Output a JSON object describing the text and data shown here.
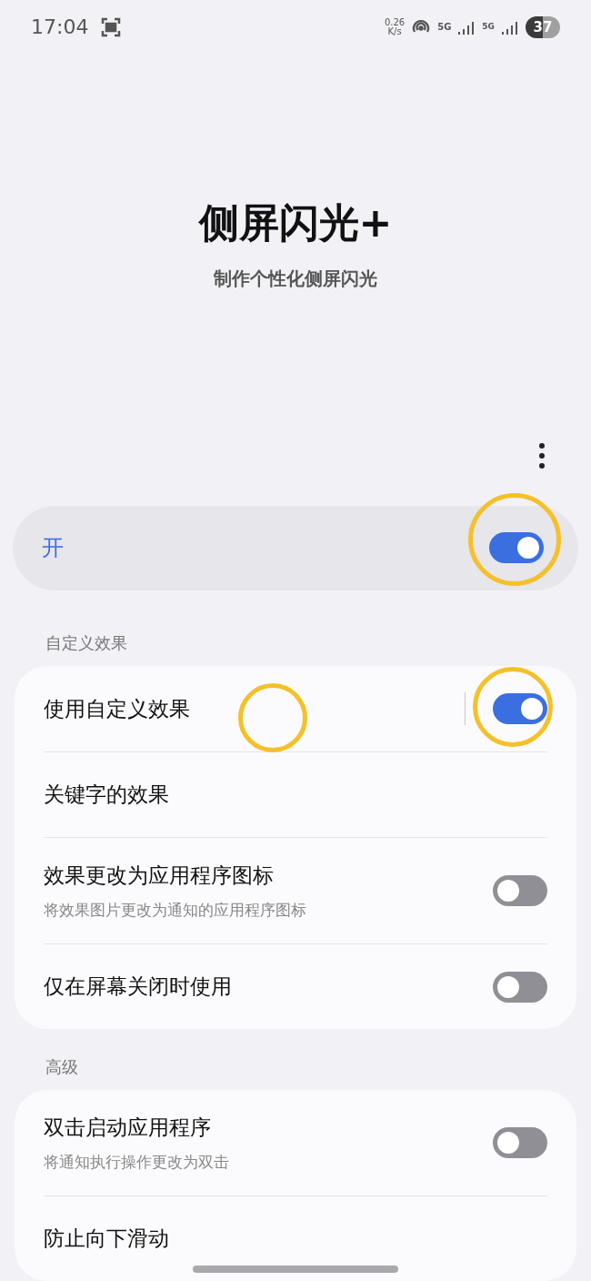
{
  "status_bar": {
    "time": "17:04",
    "net_speed": "0.26",
    "net_unit": "K/s",
    "network_1": "5G",
    "network_2": "5G",
    "battery": "37"
  },
  "header": {
    "title": "侧屏闪光+",
    "subtitle": "制作个性化侧屏闪光"
  },
  "master_switch": {
    "label": "开",
    "on": true
  },
  "sections": [
    {
      "title": "自定义效果",
      "items": [
        {
          "kind": "toggle",
          "label": "使用自定义效果",
          "on": true,
          "split": true
        },
        {
          "kind": "link",
          "label": "关键字的效果"
        },
        {
          "kind": "toggle",
          "label": "效果更改为应用程序图标",
          "description": "将效果图片更改为通知的应用程序图标",
          "on": false
        },
        {
          "kind": "toggle",
          "label": "仅在屏幕关闭时使用",
          "on": false
        }
      ]
    },
    {
      "title": "高级",
      "items": [
        {
          "kind": "toggle",
          "label": "双击启动应用程序",
          "description": "将通知执行操作更改为双击",
          "on": false
        },
        {
          "kind": "link",
          "label": "防止向下滑动"
        }
      ]
    }
  ]
}
